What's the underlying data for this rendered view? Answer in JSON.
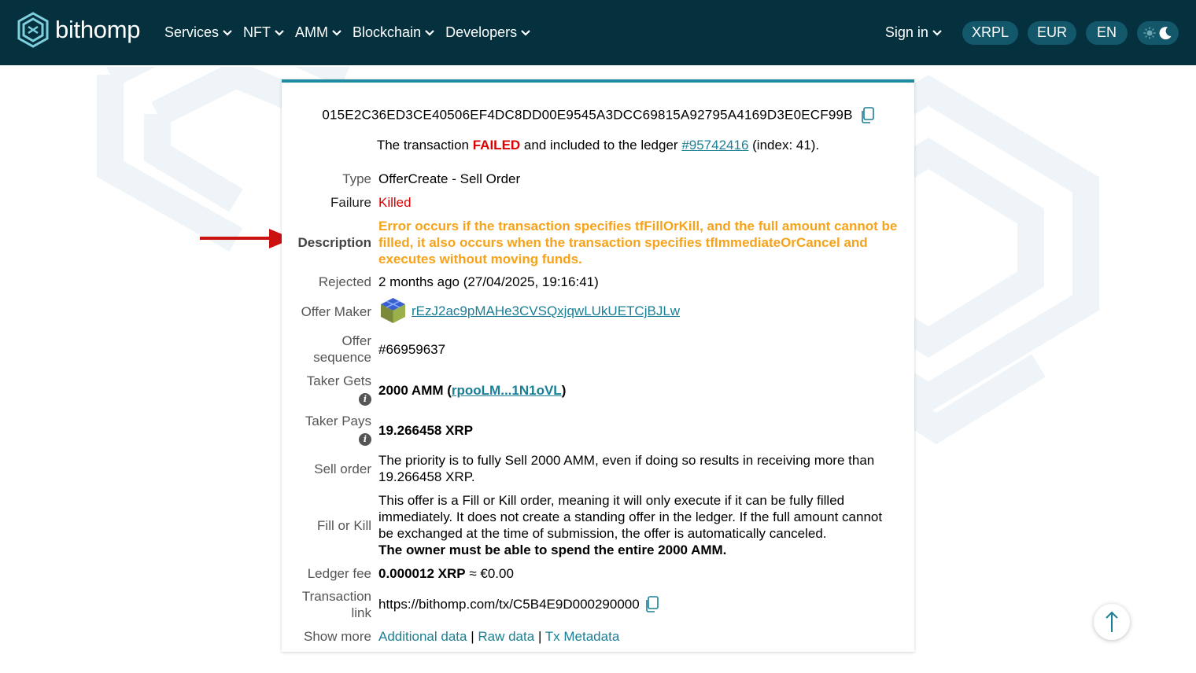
{
  "header": {
    "logo_text": "bithomp",
    "nav": [
      "Services",
      "NFT",
      "AMM",
      "Blockchain",
      "Developers"
    ],
    "sign_in": "Sign in",
    "network": "XRPL",
    "currency": "EUR",
    "language": "EN"
  },
  "tx": {
    "hash": "015E2C36ED3CE40506EF4DC8DD00E9545A3DCC69815A92795A4169D3E0ECF99B",
    "status_prefix": "The transaction",
    "status_word": "FAILED",
    "status_middle": "and included to the ledger",
    "ledger_link": "#95742416",
    "status_suffix": "(index: 41).",
    "type_label": "Type",
    "type_value": "OfferCreate - Sell Order",
    "failure_label": "Failure",
    "failure_value": "Killed",
    "description_label": "Description",
    "description_value": "Error occurs if the transaction specifies tfFillOrKill, and the full amount cannot be filled, it also occurs when the transaction specifies tfImmediateOrCancel and executes without moving funds.",
    "rejected_label": "Rejected",
    "rejected_value": "2 months ago (27/04/2025, 19:16:41)",
    "offer_maker_label": "Offer Maker",
    "offer_maker_value": "rEzJ2ac9pMAHe3CVSQxjqwLUkUETCjBJLw",
    "offer_sequence_label_1": "Offer",
    "offer_sequence_label_2": "sequence",
    "offer_sequence_value": "#66959637",
    "taker_gets_label": "Taker Gets",
    "taker_gets_amount": "2000 AMM (",
    "taker_gets_issuer": "rpooLM...1N1oVL",
    "taker_gets_close": ")",
    "taker_pays_label": "Taker Pays",
    "taker_pays_value": "19.266458 XRP",
    "sell_order_label": "Sell order",
    "sell_order_value": "The priority is to fully Sell 2000 AMM, even if doing so results in receiving more than 19.266458 XRP.",
    "fok_label": "Fill or Kill",
    "fok_value": "This offer is a Fill or Kill order, meaning it will only execute if it can be fully filled immediately. It does not create a standing offer in the ledger. If the full amount cannot be exchanged at the time of submission, the offer is automatically canceled.",
    "fok_bold": "The owner must be able to spend the entire 2000 AMM.",
    "ledger_fee_label": "Ledger fee",
    "ledger_fee_value": "0.000012 XRP",
    "ledger_fee_fiat": "≈ €0.00",
    "tx_link_label_1": "Transaction",
    "tx_link_label_2": "link",
    "tx_link_value": "https://bithomp.com/tx/C5B4E9D000290000",
    "show_more_label": "Show more",
    "show_more_links": [
      "Additional data",
      "Raw data",
      "Tx Metadata"
    ],
    "separator": "|"
  },
  "colors": {
    "header_bg": "#05303e",
    "accent": "#1a7f95",
    "failed": "#dd0000",
    "warning": "#f6a31a",
    "arrow": "#cc1111"
  },
  "icons": [
    "chevron-down-icon",
    "copy-icon",
    "info-icon",
    "sun-icon",
    "moon-icon",
    "arrow-up-icon",
    "avatar"
  ]
}
